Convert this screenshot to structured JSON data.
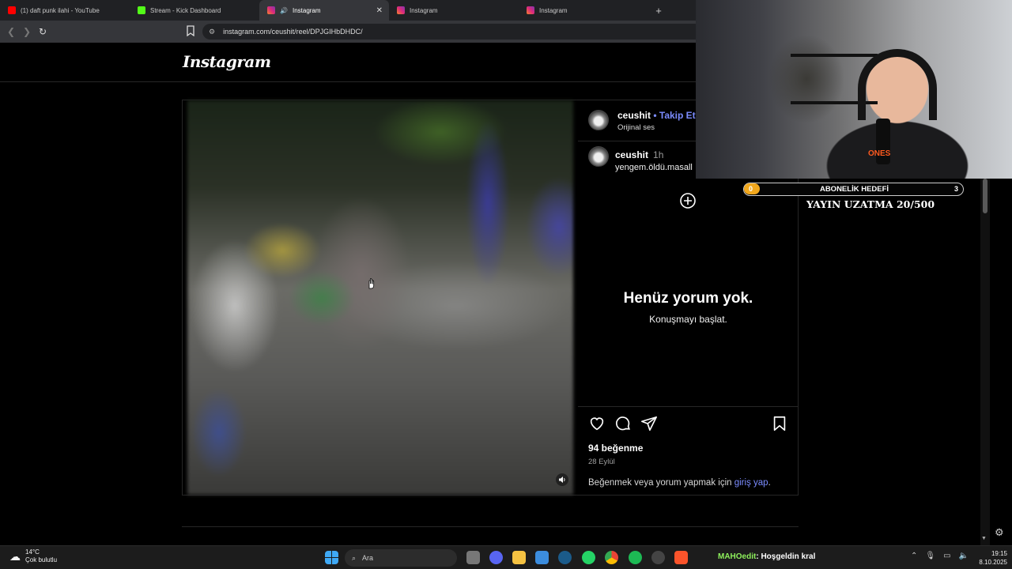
{
  "browser": {
    "tabs": [
      {
        "title": "(1) daft punk ilahi - YouTube",
        "favicon_color": "#ff0000",
        "active": false
      },
      {
        "title": "Stream - Kick Dashboard",
        "favicon_color": "#53fc18",
        "active": false
      },
      {
        "title": "Instagram",
        "favicon_color": "#dd2a7b",
        "active": true
      },
      {
        "title": "Instagram",
        "favicon_color": "#dd2a7b",
        "active": false
      },
      {
        "title": "Instagram",
        "favicon_color": "#dd2a7b",
        "active": false
      }
    ],
    "new_tab_symbol": "+",
    "url": "instagram.com/ceushit/reel/DPJGIHbDHDC/"
  },
  "instagram": {
    "logo": "Instagram",
    "post": {
      "username": "ceushit",
      "follow_label": "• Takip Et",
      "audio": "Orijinal ses",
      "caption_time": "1h",
      "caption": "yengem.öldü.masall",
      "empty_comments_title": "Henüz yorum yok.",
      "empty_comments_sub": "Konuşmayı başlat.",
      "likes": "94 beğenme",
      "date": "28 Eylül",
      "login_prompt": "Beğenmek veya yorum yapmak için",
      "login_link": "giriş yap",
      "login_suffix": "."
    }
  },
  "stream_overlay": {
    "goal_label": "ABONELİK HEDEFİ",
    "goal_current": "0",
    "goal_target": "3",
    "goal_fill_color": "#f2a81d",
    "extend_text": "YAYIN UZATMA 20/500",
    "mic_brand": "ONES"
  },
  "taskbar": {
    "weather_temp": "14°C",
    "weather_desc": "Çok bulutlu",
    "search_placeholder": "Ara",
    "chat_user": "MAHOedit",
    "chat_message": ": Hoşgeldin kral",
    "time": "19:15",
    "date": "8.10.2025"
  }
}
